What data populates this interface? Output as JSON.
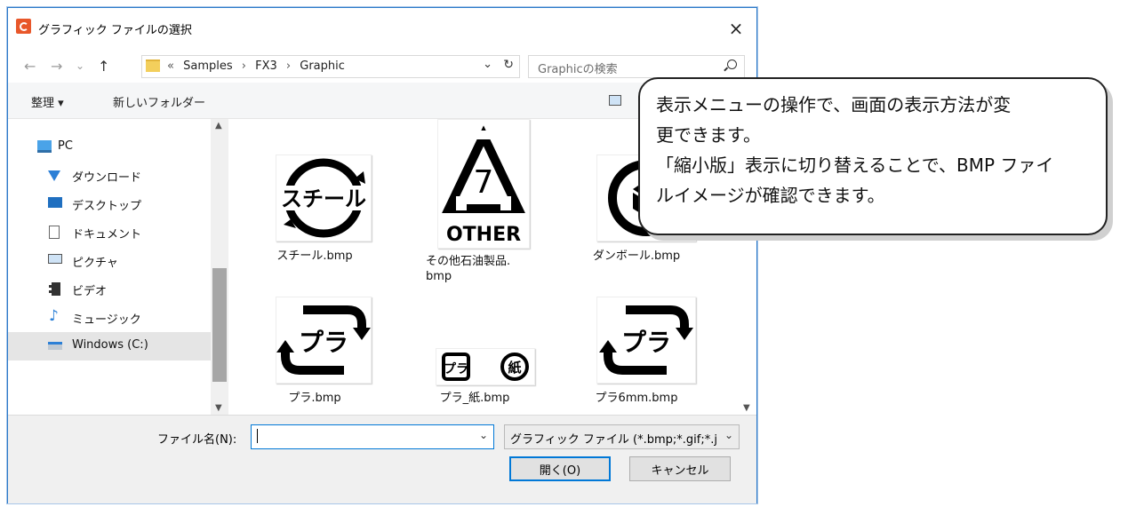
{
  "window": {
    "title": "グラフィック ファイルの選択",
    "close": "×"
  },
  "nav": {
    "back": "←",
    "forward": "→",
    "recent": "⌄",
    "up": "↑"
  },
  "address": {
    "crumbs": [
      "«",
      "Samples",
      "›",
      "FX3",
      "›",
      "Graphic"
    ],
    "dropdown": "⌄",
    "refresh": "↻"
  },
  "search": {
    "placeholder": "Graphicの検索"
  },
  "toolbar": {
    "organize": "整理 ▾",
    "new_folder": "新しいフォルダー"
  },
  "sidebar": {
    "items": [
      {
        "label": "PC",
        "icon": "pc-icon"
      },
      {
        "label": "ダウンロード",
        "icon": "download-icon"
      },
      {
        "label": "デスクトップ",
        "icon": "desktop-icon"
      },
      {
        "label": "ドキュメント",
        "icon": "document-icon"
      },
      {
        "label": "ピクチャ",
        "icon": "picture-icon"
      },
      {
        "label": "ビデオ",
        "icon": "video-icon"
      },
      {
        "label": "ミュージック",
        "icon": "music-icon"
      },
      {
        "label": "Windows (C:)",
        "icon": "drive-icon"
      }
    ]
  },
  "files": [
    {
      "name": "スチール.bmp",
      "symbol": "スチール"
    },
    {
      "name": "その他石油製品.\nbmp",
      "symbol": "7",
      "sub": "OTHER"
    },
    {
      "name": "ダンボール.bmp",
      "symbol": ""
    },
    {
      "name": "プラ.bmp",
      "symbol": "プラ"
    },
    {
      "name": "プラ_紙.bmp",
      "symbol": "プラ",
      "symbol2": "紙"
    },
    {
      "name": "プラ6mm.bmp",
      "symbol": "プラ"
    }
  ],
  "bottom": {
    "filename_label": "ファイル名(N):",
    "filename_value": "",
    "filter": "グラフィック ファイル (*.bmp;*.gif;*.j",
    "open": "開く(O)",
    "cancel": "キャンセル"
  },
  "callout": {
    "lines": [
      "表示メニューの操作で、画面の表示方法が変",
      "更できます。",
      "「縮小版」表示に切り替えることで、BMP ファイ",
      "ルイメージが確認できます。"
    ]
  },
  "colors": {
    "accent": "#0078d7",
    "selected": "#e5e5e5",
    "toolbar": "#f5f6f7",
    "bottom": "#f0f0f0"
  }
}
